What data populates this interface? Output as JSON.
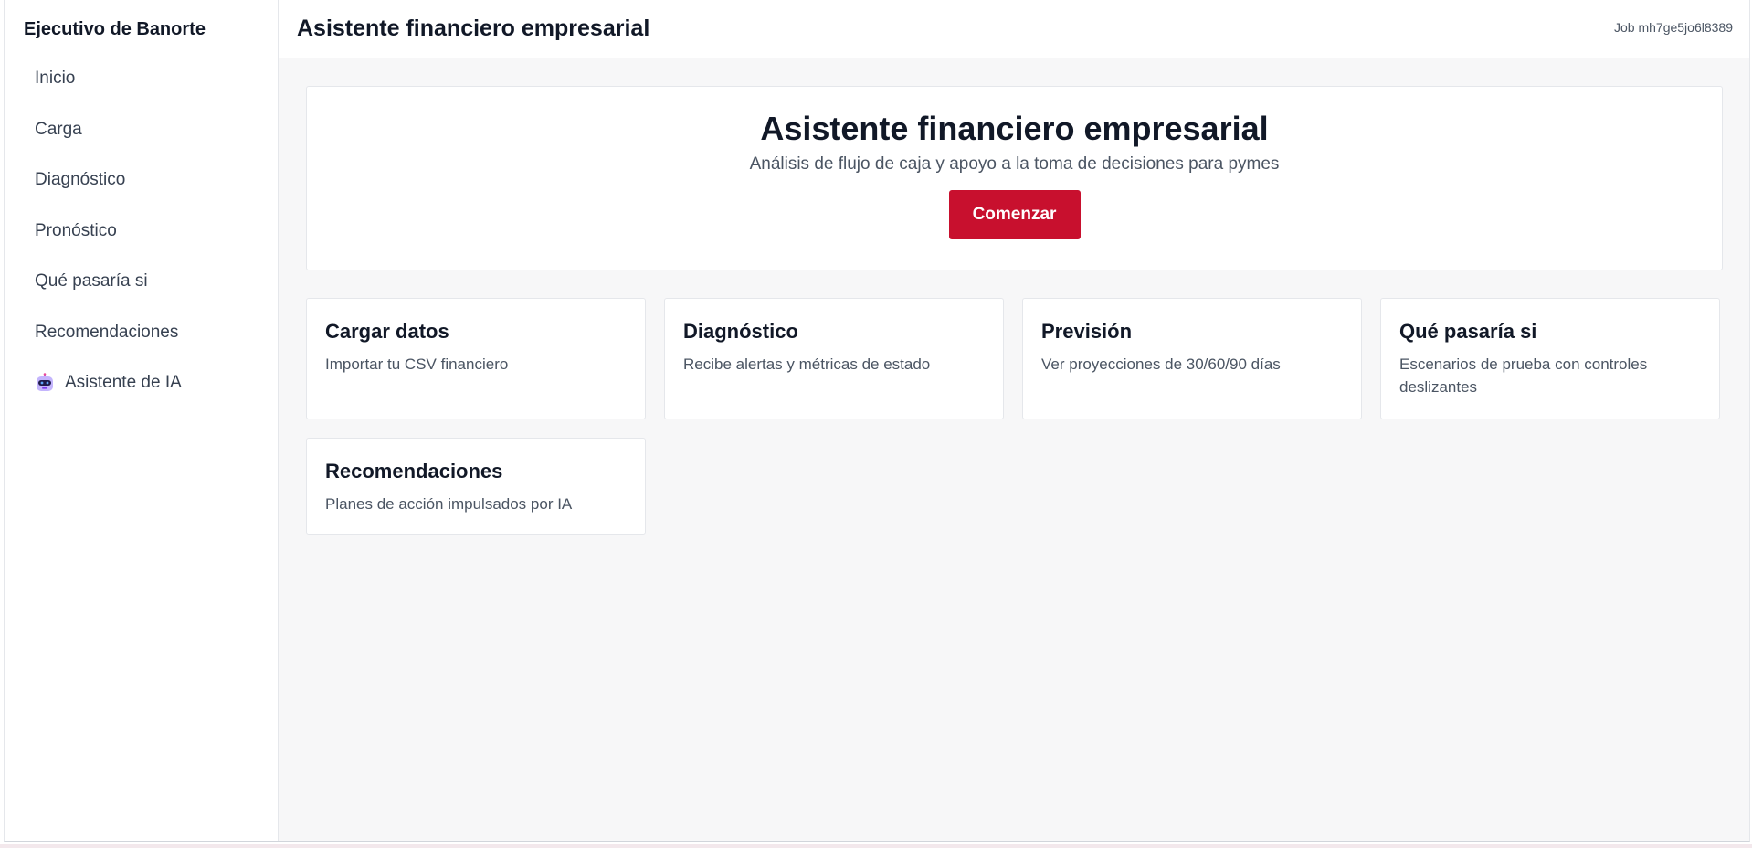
{
  "sidebar": {
    "brand": "Ejecutivo de Banorte",
    "items": [
      {
        "label": "Inicio"
      },
      {
        "label": "Carga"
      },
      {
        "label": "Diagnóstico"
      },
      {
        "label": "Pronóstico"
      },
      {
        "label": "Qué pasaría si"
      },
      {
        "label": "Recomendaciones"
      },
      {
        "label": "Asistente de IA",
        "icon": "robot-icon"
      }
    ]
  },
  "header": {
    "title": "Asistente financiero empresarial",
    "job_id": "Job mh7ge5jo6l8389"
  },
  "hero": {
    "title": "Asistente financiero empresarial",
    "subtitle": "Análisis de flujo de caja y apoyo a la toma de decisiones para pymes",
    "cta_label": "Comenzar"
  },
  "cards": [
    {
      "title": "Cargar datos",
      "description": "Importar tu CSV financiero"
    },
    {
      "title": "Diagnóstico",
      "description": "Recibe alertas y métricas de estado"
    },
    {
      "title": "Previsión",
      "description": "Ver proyecciones de 30/60/90 días"
    },
    {
      "title": "Qué pasaría si",
      "description": "Escenarios de prueba con controles deslizantes"
    },
    {
      "title": "Recomendaciones",
      "description": "Planes de acción impulsados por IA"
    }
  ],
  "colors": {
    "accent": "#c8102e",
    "background": "#f7f7f8",
    "text": "#111827",
    "muted_text": "#4b5563"
  }
}
